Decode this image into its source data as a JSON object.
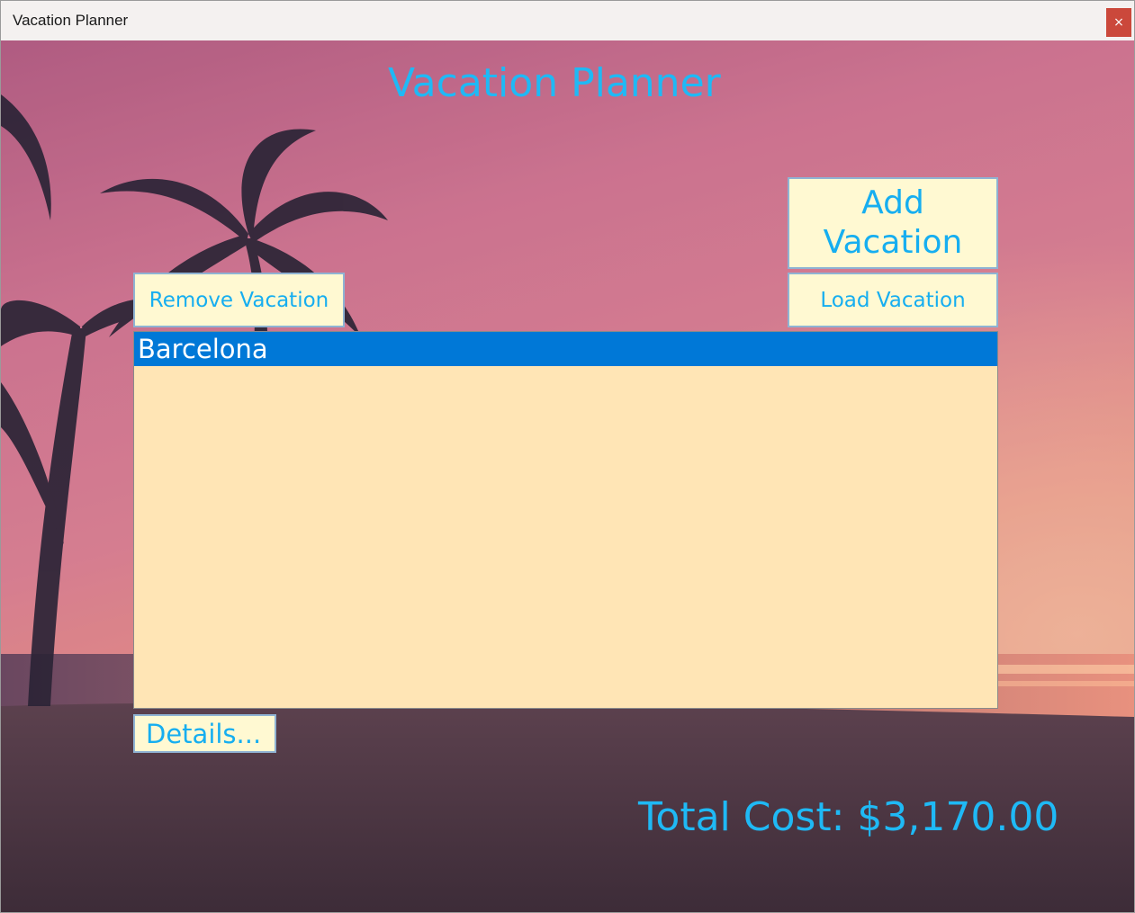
{
  "window": {
    "title": "Vacation Planner",
    "close_glyph": "×"
  },
  "app": {
    "title": "Vacation Planner",
    "accent_color": "#1fb9f5",
    "button_bg": "#fff9d2",
    "list_bg": "#ffe5b5",
    "selection_color": "#0078d7"
  },
  "buttons": {
    "add_vacation": "Add Vacation",
    "load_vacation": "Load Vacation",
    "remove_vacation": "Remove Vacation",
    "details": "Details..."
  },
  "vacations": {
    "items": [
      {
        "label": "Barcelona",
        "selected": true
      }
    ]
  },
  "summary": {
    "total_cost": "Total Cost: $3,170.00"
  },
  "icons": {
    "close": "close-icon"
  }
}
